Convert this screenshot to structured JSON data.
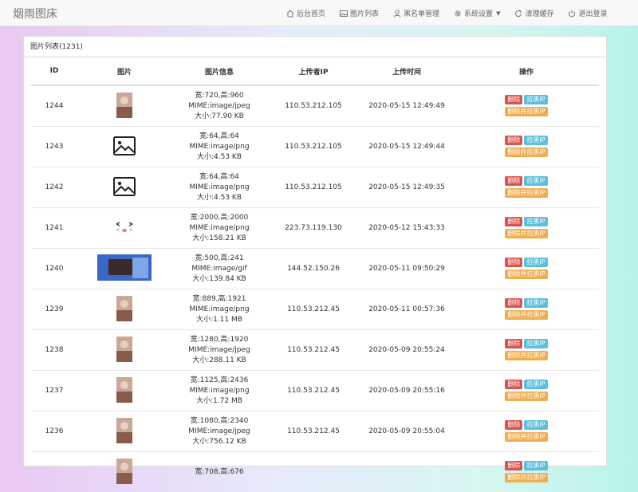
{
  "app": {
    "title": "烟雨图床"
  },
  "nav": {
    "items": [
      {
        "label": "后台首页",
        "icon": "home-icon"
      },
      {
        "label": "图片列表",
        "icon": "image-icon"
      },
      {
        "label": "黑名单管理",
        "icon": "user-icon"
      },
      {
        "label": "系统设置",
        "icon": "gear-icon"
      },
      {
        "label": "清理缓存",
        "icon": "refresh-icon"
      },
      {
        "label": "退出登录",
        "icon": "power-icon"
      }
    ]
  },
  "panel": {
    "heading": "图片列表(1231)"
  },
  "table": {
    "headers": [
      "ID",
      "图片",
      "图片信息",
      "上传者IP",
      "上传时间",
      "操作"
    ],
    "rows": [
      {
        "id": "1244",
        "size": "宽:720,高:960",
        "mime": "MIME:image/jpeg",
        "filesize": "大小:77.90 KB",
        "ip": "110.53.212.105",
        "time": "2020-05-15 12:49:49",
        "thumb": "photo-portrait"
      },
      {
        "id": "1243",
        "size": "宽:64,高:64",
        "mime": "MIME:image/png",
        "filesize": "大小:4.53 KB",
        "ip": "110.53.212.105",
        "time": "2020-05-15 12:49:44",
        "thumb": "image-icon"
      },
      {
        "id": "1242",
        "size": "宽:64,高:64",
        "mime": "MIME:image/png",
        "filesize": "大小:4.53 KB",
        "ip": "110.53.212.105",
        "time": "2020-05-15 12:49:35",
        "thumb": "image-icon"
      },
      {
        "id": "1241",
        "size": "宽:2000,高:2000",
        "mime": "MIME:image/png",
        "filesize": "大小:158.21 KB",
        "ip": "223.73.119.130",
        "time": "2020-05-12 15:43:33",
        "thumb": "emoji-face"
      },
      {
        "id": "1240",
        "size": "宽:500,高:241",
        "mime": "MIME:image/gif",
        "filesize": "大小:139.84 KB",
        "ip": "144.52.150.26",
        "time": "2020-05-11 09:50:29",
        "thumb": "photo-wide"
      },
      {
        "id": "1239",
        "size": "宽:889,高:1921",
        "mime": "MIME:image/png",
        "filesize": "大小:1.11 MB",
        "ip": "110.53.212.45",
        "time": "2020-05-11 00:57:36",
        "thumb": "photo-portrait"
      },
      {
        "id": "1238",
        "size": "宽:1280,高:1920",
        "mime": "MIME:image/jpeg",
        "filesize": "大小:288.11 KB",
        "ip": "110.53.212.45",
        "time": "2020-05-09 20:55:24",
        "thumb": "photo-portrait"
      },
      {
        "id": "1237",
        "size": "宽:1125,高:2436",
        "mime": "MIME:image/png",
        "filesize": "大小:1.72 MB",
        "ip": "110.53.212.45",
        "time": "2020-05-09 20:55:16",
        "thumb": "photo-portrait"
      },
      {
        "id": "1236",
        "size": "宽:1080,高:2340",
        "mime": "MIME:image/jpeg",
        "filesize": "大小:756.12 KB",
        "ip": "110.53.212.45",
        "time": "2020-05-09 20:55:04",
        "thumb": "photo-portrait"
      },
      {
        "id": "",
        "size": "宽:708,高:676",
        "mime": "",
        "filesize": "",
        "ip": "",
        "time": "",
        "thumb": "photo-portrait"
      }
    ],
    "actions": {
      "delete": "删除",
      "block": "拉黑IP",
      "delete_block": "删除并拉黑IP"
    }
  },
  "colors": {
    "danger": "#d9534f",
    "info": "#5bc0de",
    "warning": "#f0ad4e"
  }
}
